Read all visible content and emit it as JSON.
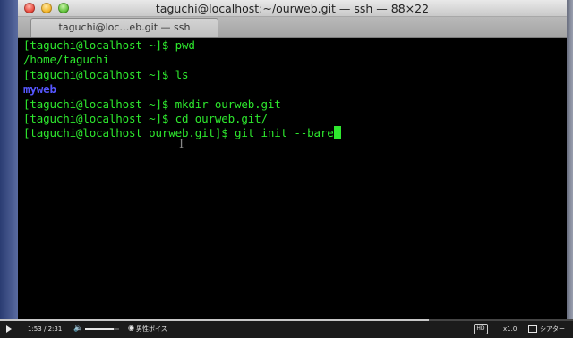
{
  "window": {
    "title": "taguchi@localhost:~/ourweb.git — ssh — 88×22",
    "tab_label": "taguchi@loc…eb.git — ssh"
  },
  "terminal": {
    "lines": [
      {
        "text": "[taguchi@localhost ~]$ pwd"
      },
      {
        "text": "/home/taguchi"
      },
      {
        "text": "[taguchi@localhost ~]$ ls"
      },
      {
        "text": "myweb",
        "style": "directory"
      },
      {
        "text": "[taguchi@localhost ~]$ mkdir ourweb.git"
      },
      {
        "text": "[taguchi@localhost ~]$ cd ourweb.git/"
      },
      {
        "text": "[taguchi@localhost ourweb.git]$ git init --bare",
        "cursor": true
      }
    ],
    "colors": {
      "text": "#2ee82e",
      "directory": "#5656ff",
      "background": "#000000"
    }
  },
  "player": {
    "current_time": "1:53",
    "separator": "/",
    "duration": "2:31",
    "progress_fraction": 0.748,
    "volume_fraction": 0.85,
    "voice_label": "男性ボイス",
    "hd_label": "HD",
    "speed_label": "x1.0",
    "theater_label": "シアター",
    "icons": [
      "play-icon",
      "speaker-icon",
      "speech-bubble-icon",
      "theater-icon"
    ]
  }
}
